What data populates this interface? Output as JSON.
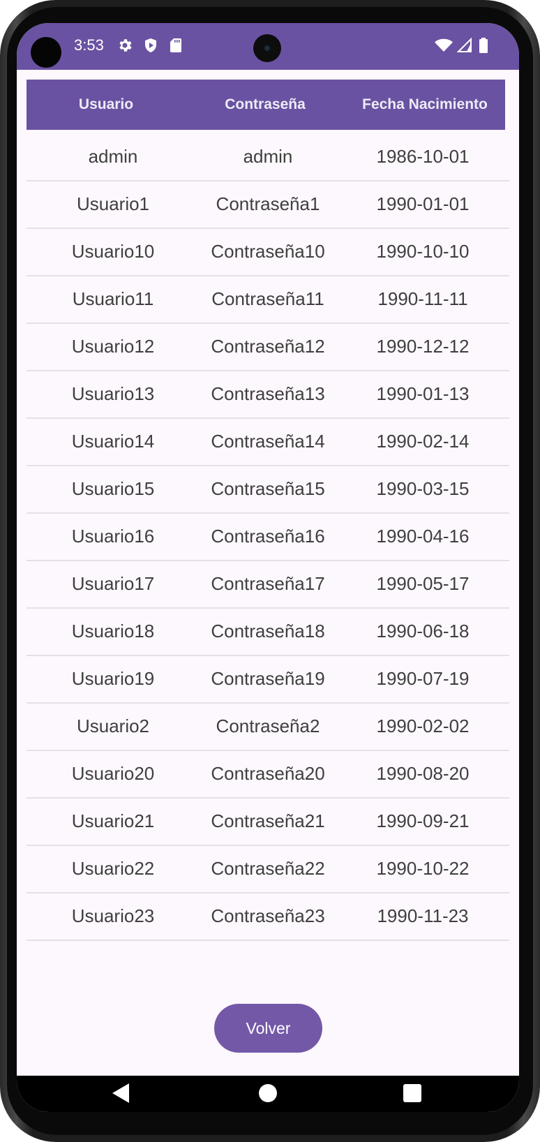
{
  "status_bar": {
    "time": "3:53"
  },
  "table": {
    "headers": [
      "Usuario",
      "Contraseña",
      "Fecha Nacimiento"
    ],
    "rows": [
      [
        "admin",
        "admin",
        "1986-10-01"
      ],
      [
        "Usuario1",
        "Contraseña1",
        "1990-01-01"
      ],
      [
        "Usuario10",
        "Contraseña10",
        "1990-10-10"
      ],
      [
        "Usuario11",
        "Contraseña11",
        "1990-11-11"
      ],
      [
        "Usuario12",
        "Contraseña12",
        "1990-12-12"
      ],
      [
        "Usuario13",
        "Contraseña13",
        "1990-01-13"
      ],
      [
        "Usuario14",
        "Contraseña14",
        "1990-02-14"
      ],
      [
        "Usuario15",
        "Contraseña15",
        "1990-03-15"
      ],
      [
        "Usuario16",
        "Contraseña16",
        "1990-04-16"
      ],
      [
        "Usuario17",
        "Contraseña17",
        "1990-05-17"
      ],
      [
        "Usuario18",
        "Contraseña18",
        "1990-06-18"
      ],
      [
        "Usuario19",
        "Contraseña19",
        "1990-07-19"
      ],
      [
        "Usuario2",
        "Contraseña2",
        "1990-02-02"
      ],
      [
        "Usuario20",
        "Contraseña20",
        "1990-08-20"
      ],
      [
        "Usuario21",
        "Contraseña21",
        "1990-09-21"
      ],
      [
        "Usuario22",
        "Contraseña22",
        "1990-10-22"
      ],
      [
        "Usuario23",
        "Contraseña23",
        "1990-11-23"
      ]
    ]
  },
  "actions": {
    "back_label": "Volver"
  },
  "colors": {
    "primary": "#6a52a2",
    "button": "#7458a8",
    "background": "#fdf8fd",
    "text": "#3f3f3f"
  },
  "icons": [
    "settings-icon",
    "play-protect-icon",
    "sd-card-icon",
    "wifi-icon",
    "signal-icon",
    "battery-icon",
    "nav-back-icon",
    "nav-home-icon",
    "nav-recents-icon"
  ]
}
